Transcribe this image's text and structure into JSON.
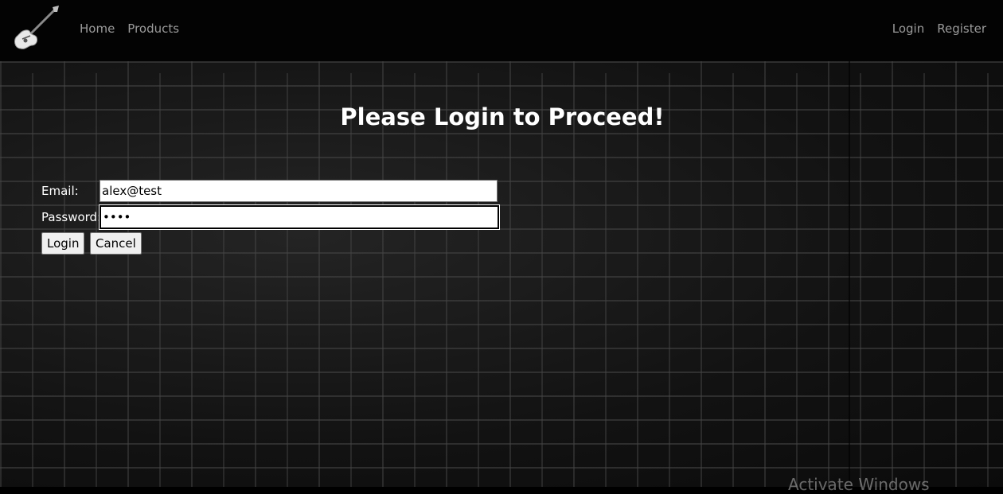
{
  "nav": {
    "brand_icon": "guitar-icon",
    "left_links": [
      "Home",
      "Products"
    ],
    "right_links": [
      "Login",
      "Register"
    ]
  },
  "main": {
    "title": "Please Login to Proceed!",
    "email_label": "Email:",
    "email_value": "alex@test",
    "password_label": "Password:",
    "password_value": "••••",
    "login_button": "Login",
    "cancel_button": "Cancel"
  },
  "watermark": "Activate Windows",
  "colors": {
    "nav_bg": "#030303",
    "nav_link": "#9b9b9b",
    "text": "#ffffff"
  }
}
